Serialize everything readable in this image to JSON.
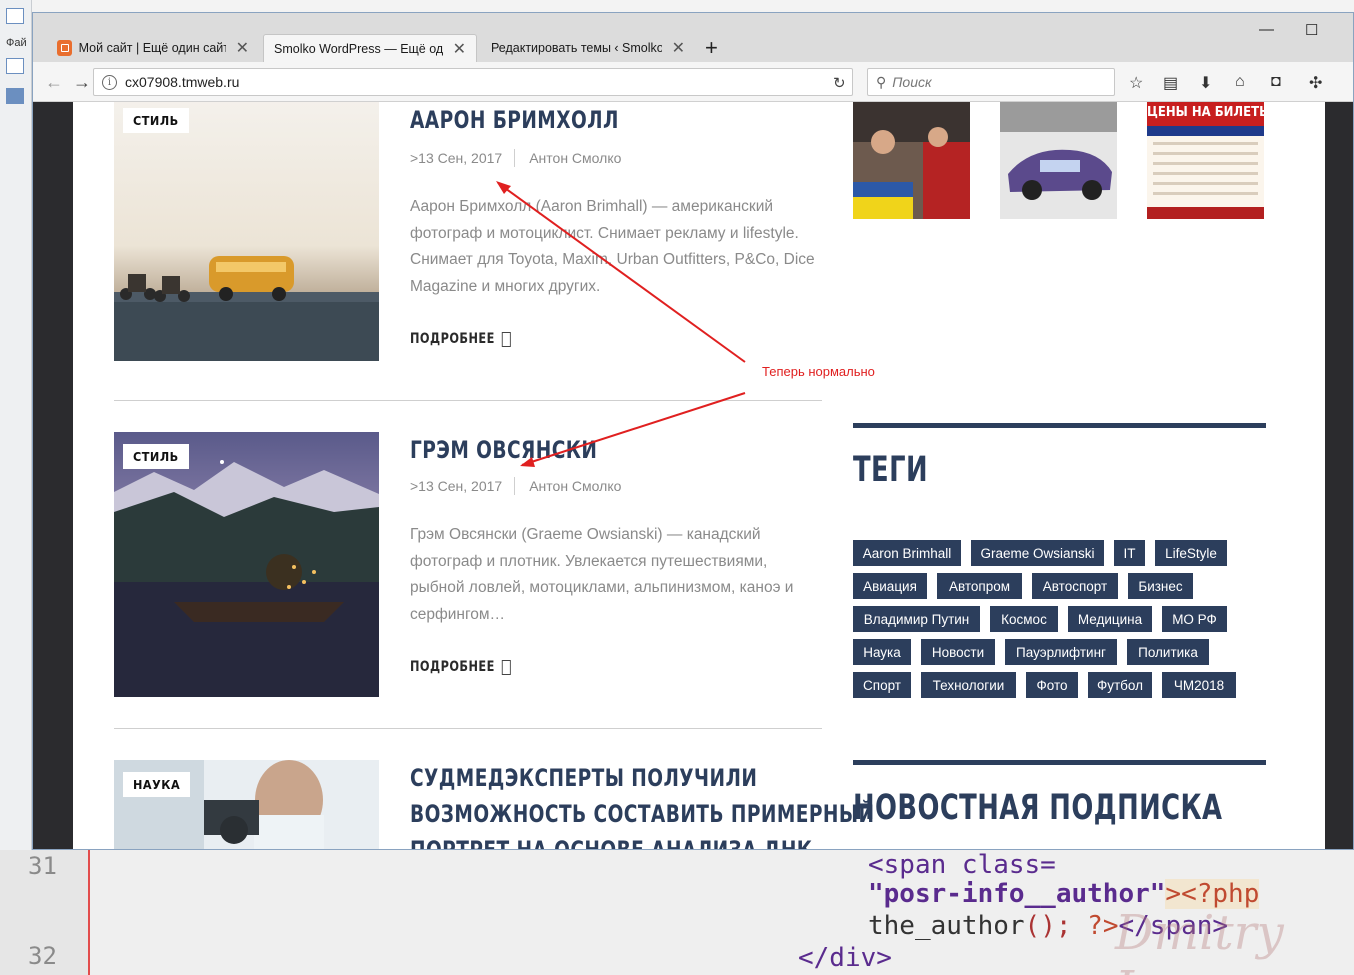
{
  "background_editor": {
    "menu_label": "Фай",
    "code_line_numbers": [
      "31",
      "32"
    ],
    "code_line_1_a": "<span class=",
    "code_line_2_a": "\"posr-info__author\"",
    "code_line_2_b": "><?php",
    "code_line_3_a": "the_author",
    "code_line_3_b": "();",
    "code_line_3_c": "?>",
    "code_line_3_d": "</span>",
    "code_line_4": "</div>",
    "watermark": "Dmitry Lav"
  },
  "browser": {
    "tabs": [
      {
        "label": "Мой сайт | Ещё один сайт н"
      },
      {
        "label": "Smolko WordPress — Ещё один"
      },
      {
        "label": "Редактировать темы ‹ Smolko W"
      }
    ],
    "close_glyph": "✕",
    "new_tab": "+",
    "url": "cx07908.tmweb.ru",
    "search_placeholder": "Поиск"
  },
  "posts": [
    {
      "category": "СТИЛЬ",
      "title": "ААРОН БРИМХОЛЛ",
      "date": ">13 Сен, 2017",
      "author": "Антон Смолко",
      "excerpt": "Аарон Бримхолл (Aaron Brimhall) — американский фотограф и мотоциклист. Снимает рекламу и lifestyle. Снимает для Toyota, Maxim, Urban Outfitters, P&Co, Dice Magazine и многих других.",
      "more": "ПОДРОБНЕЕ"
    },
    {
      "category": "СТИЛЬ",
      "title": "ГРЭМ ОВСЯНСКИ",
      "date": ">13 Сен, 2017",
      "author": "Антон Смолко",
      "excerpt": "Грэм Овсянски (Graeme Owsianski) — канадский фотограф и плотник. Увлекается путешествиями, рыбной ловлей, мотоциклами, альпинизмом, каноэ и серфингом…",
      "more": "ПОДРОБНЕЕ"
    },
    {
      "category": "НАУКА",
      "title_line1": "СУДМЕДЭКСПЕРТЫ ПОЛУЧИЛИ",
      "title_line2": "ВОЗМОЖНОСТЬ СОСТАВИТЬ ПРИМЕРНЫЙ",
      "title_line3": "ПОРТРЕТ НА ОСНОВЕ АНАЛИЗА ДНК"
    }
  ],
  "sidebar": {
    "instagram_poster_text": "ЦЕНЫ НА БИЛЕТЫ",
    "tags_title": "ТЕГИ",
    "tags": [
      "Aaron Brimhall",
      "Graeme Owsianski",
      "IT",
      "LifeStyle",
      "Авиация",
      "Автопром",
      "Автоспорт",
      "Бизнес",
      "Владимир Путин",
      "Космос",
      "Медицина",
      "МО РФ",
      "Наука",
      "Новости",
      "Пауэрлифтинг",
      "Политика",
      "Спорт",
      "Технологии",
      "Фото",
      "Футбол",
      "ЧМ2018"
    ],
    "newsletter_title": "НОВОСТНАЯ ПОДПИСКА"
  },
  "annotation": {
    "text": "Теперь нормально",
    "color": "#e02020"
  },
  "colors": {
    "brand_navy": "#2c3e5c"
  }
}
